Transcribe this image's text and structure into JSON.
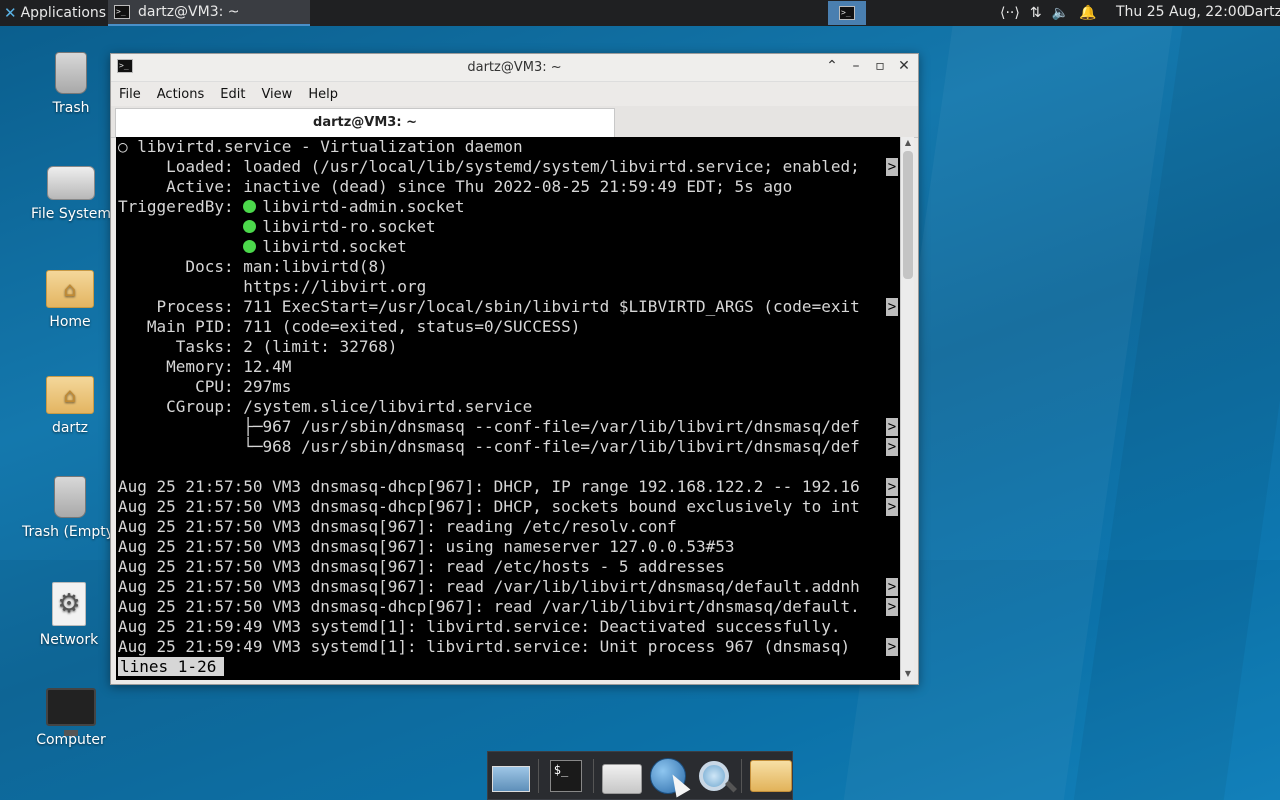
{
  "top_panel": {
    "apps_label": "Applications",
    "task_label": "dartz@VM3: ~",
    "clock": "Thu 25 Aug, 22:00",
    "user": "Dartz"
  },
  "desktop_icons": [
    {
      "label": "Trash"
    },
    {
      "label": "File System"
    },
    {
      "label": "Home"
    },
    {
      "label": "dartz"
    },
    {
      "label": "Trash (Empty)"
    },
    {
      "label": "Network"
    },
    {
      "label": "Computer"
    }
  ],
  "window": {
    "title": "dartz@VM3: ~",
    "menu": [
      "File",
      "Actions",
      "Edit",
      "View",
      "Help"
    ],
    "tab_label": "dartz@VM3: ~"
  },
  "terminal": {
    "lines": [
      "○ libvirtd.service - Virtualization daemon",
      "     Loaded: loaded (/usr/local/lib/systemd/system/libvirtd.service; enabled;",
      "     Active: inactive (dead) since Thu 2022-08-25 21:59:49 EDT; 5s ago",
      "TriggeredBy: ",
      "             ",
      "             ",
      "       Docs: man:libvirtd(8)",
      "             https://libvirt.org",
      "    Process: 711 ExecStart=/usr/local/sbin/libvirtd $LIBVIRTD_ARGS (code=exit",
      "   Main PID: 711 (code=exited, status=0/SUCCESS)",
      "      Tasks: 2 (limit: 32768)",
      "     Memory: 12.4M",
      "        CPU: 297ms",
      "     CGroup: /system.slice/libvirtd.service",
      "             ├─967 /usr/sbin/dnsmasq --conf-file=/var/lib/libvirt/dnsmasq/def",
      "             └─968 /usr/sbin/dnsmasq --conf-file=/var/lib/libvirt/dnsmasq/def",
      "",
      "Aug 25 21:57:50 VM3 dnsmasq-dhcp[967]: DHCP, IP range 192.168.122.2 -- 192.16",
      "Aug 25 21:57:50 VM3 dnsmasq-dhcp[967]: DHCP, sockets bound exclusively to int",
      "Aug 25 21:57:50 VM3 dnsmasq[967]: reading /etc/resolv.conf",
      "Aug 25 21:57:50 VM3 dnsmasq[967]: using nameserver 127.0.0.53#53",
      "Aug 25 21:57:50 VM3 dnsmasq[967]: read /etc/hosts - 5 addresses",
      "Aug 25 21:57:50 VM3 dnsmasq[967]: read /var/lib/libvirt/dnsmasq/default.addnh",
      "Aug 25 21:57:50 VM3 dnsmasq-dhcp[967]: read /var/lib/libvirt/dnsmasq/default.",
      "Aug 25 21:59:49 VM3 systemd[1]: libvirtd.service: Deactivated successfully.",
      "Aug 25 21:59:49 VM3 systemd[1]: libvirtd.service: Unit process 967 (dnsmasq) "
    ],
    "triggered_sockets": [
      "libvirtd-admin.socket",
      "libvirtd-ro.socket",
      "libvirtd.socket"
    ],
    "truncated_rows": [
      1,
      8,
      14,
      15,
      17,
      18,
      22,
      23,
      25
    ],
    "truncation_marker": ">",
    "status_line": "lines 1-26",
    "socket_dot_color": "#4bd84b"
  },
  "dock": {
    "items": [
      "show-desktop",
      "terminal",
      "home-folder",
      "web-browser",
      "app-finder",
      "file-manager"
    ],
    "terminal_glyph": "$_"
  }
}
